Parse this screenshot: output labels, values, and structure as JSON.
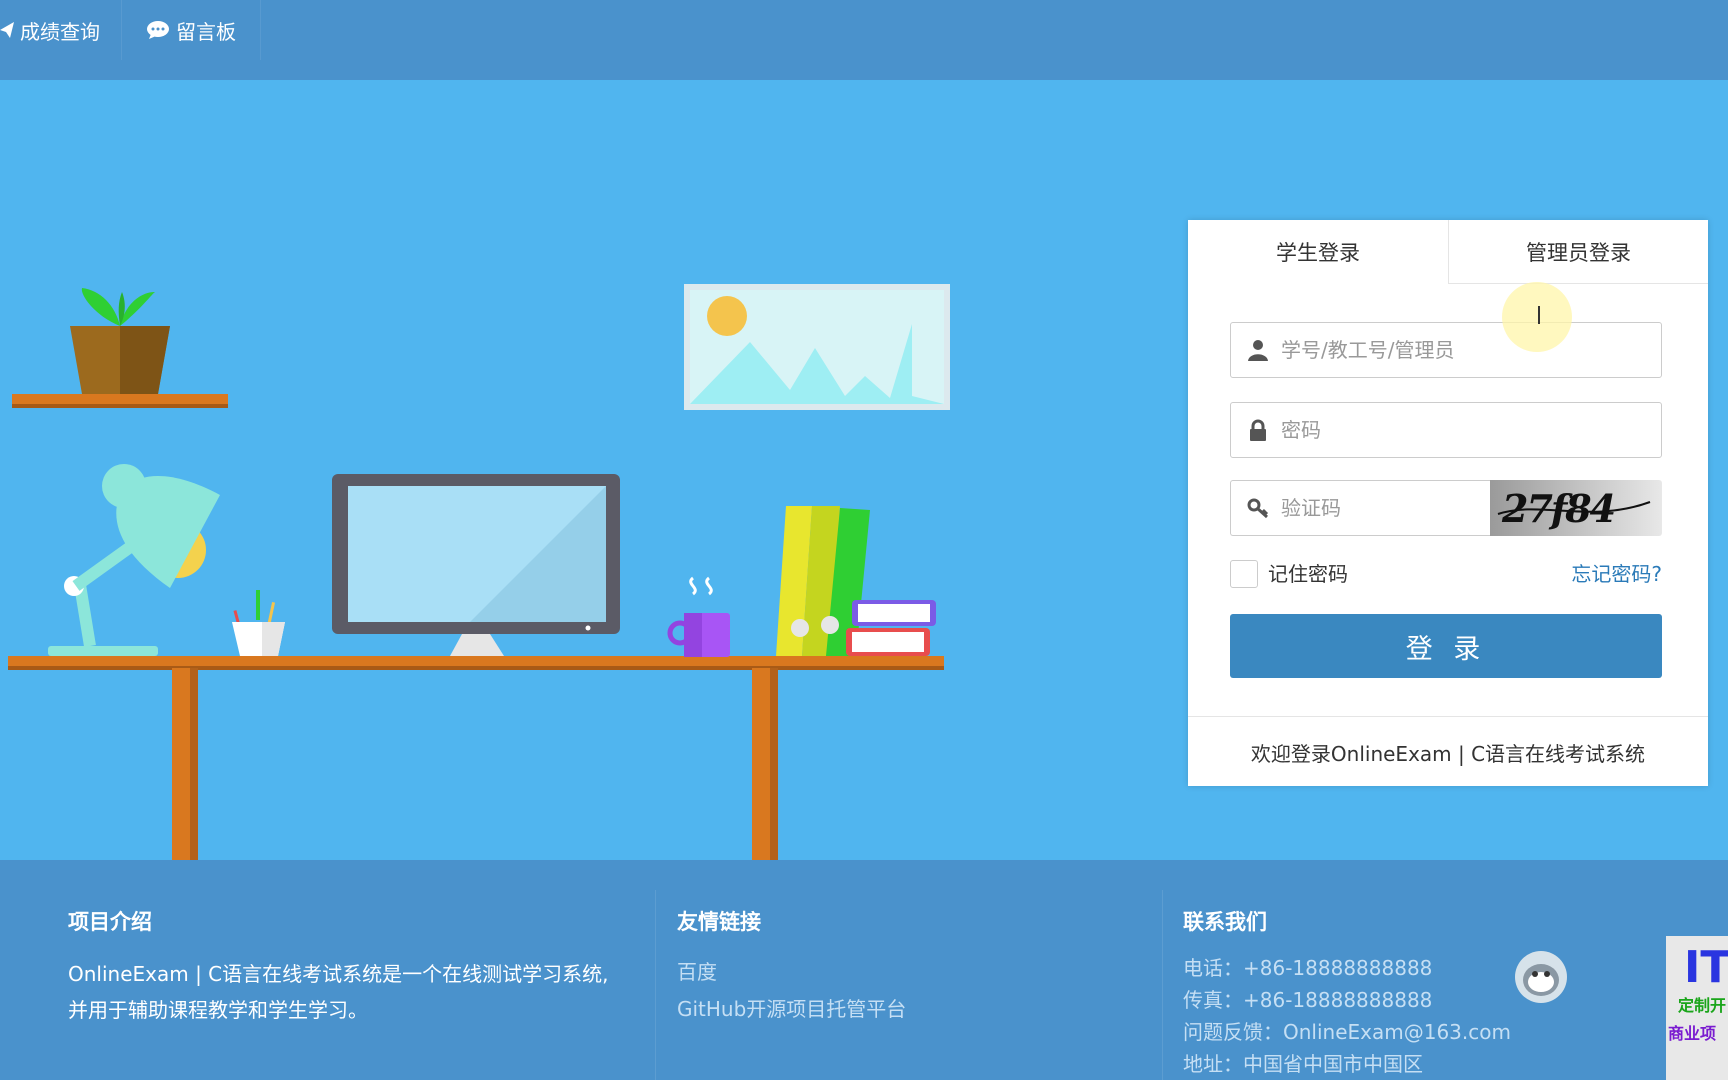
{
  "nav": {
    "items": [
      {
        "label": "成绩查询",
        "icon": "paper-plane-icon"
      },
      {
        "label": "留言板",
        "icon": "comment-icon"
      }
    ]
  },
  "login": {
    "tabs": [
      {
        "label": "学生登录",
        "active": true
      },
      {
        "label": "管理员登录",
        "active": false
      }
    ],
    "username_placeholder": "学号/教工号/管理员",
    "password_placeholder": "密码",
    "captcha_placeholder": "验证码",
    "captcha_text": "27f84",
    "remember_label": "记住密码",
    "forgot_label": "忘记密码?",
    "submit_label": "登 录",
    "footer_text": "欢迎登录OnlineExam | C语言在线考试系统"
  },
  "footer": {
    "intro": {
      "title": "项目介绍",
      "lines": [
        "OnlineExam | C语言在线考试系统是一个在线测试学习系统,",
        "并用于辅助课程教学和学生学习。"
      ]
    },
    "links": {
      "title": "友情链接",
      "items": [
        "百度",
        "GitHub开源项目托管平台"
      ]
    },
    "contact": {
      "title": "联系我们",
      "lines": [
        "电话：+86-18888888888",
        "传真：+86-18888888888",
        "问题反馈：OnlineExam@163.com",
        "地址：中国省中国市中国区"
      ]
    },
    "ad": {
      "big": "IT",
      "line1": "定制开",
      "line2": "商业项"
    }
  },
  "colors": {
    "topbar": "#4a92cc",
    "hero": "#50b5ef",
    "button": "#3a88c0",
    "link": "#2a7ab8"
  }
}
